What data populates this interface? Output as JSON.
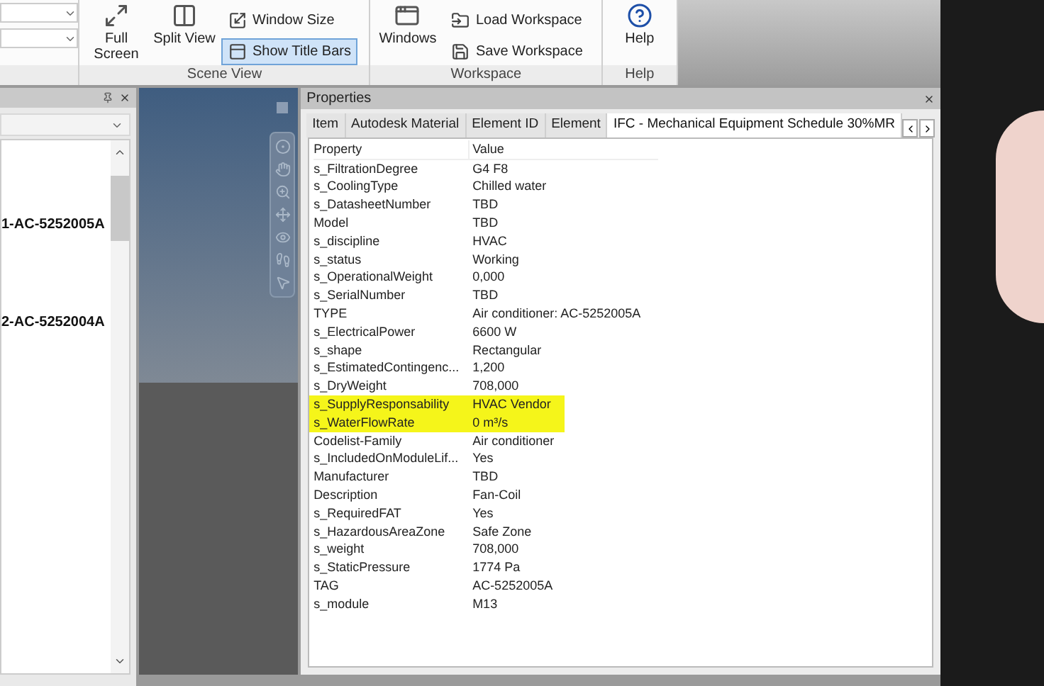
{
  "ribbon": {
    "groups": [
      {
        "kind": "scene",
        "label": "Scene View",
        "large": [
          {
            "label": "Full Screen"
          },
          {
            "label": "Split View"
          }
        ],
        "small": [
          {
            "label": "Window Size",
            "selected": false
          },
          {
            "label": "Show Title Bars",
            "selected": true
          }
        ]
      },
      {
        "kind": "workspace",
        "label": "Workspace",
        "large": [
          {
            "label": "Windows"
          }
        ],
        "small": [
          {
            "label": "Load Workspace",
            "selected": false
          },
          {
            "label": "Save Workspace",
            "selected": false
          }
        ]
      },
      {
        "kind": "help",
        "label": "Help",
        "large": [
          {
            "label": "Help"
          }
        ]
      }
    ]
  },
  "tree_panel": {
    "items": [
      "1-AC-5252005A",
      "2-AC-5252004A"
    ]
  },
  "properties": {
    "title": "Properties",
    "tabs": [
      {
        "label": "Item",
        "selected": false
      },
      {
        "label": "Autodesk Material",
        "selected": false
      },
      {
        "label": "Element ID",
        "selected": false
      },
      {
        "label": "Element",
        "selected": false
      },
      {
        "label": "IFC - Mechanical Equipment Schedule 30%MR",
        "selected": true
      }
    ],
    "columns": [
      "Property",
      "Value"
    ],
    "rows": [
      {
        "property": "s_FiltrationDegree",
        "value": "G4 F8",
        "highlighted": false
      },
      {
        "property": "s_CoolingType",
        "value": "Chilled water",
        "highlighted": false
      },
      {
        "property": "s_DatasheetNumber",
        "value": "TBD",
        "highlighted": false
      },
      {
        "property": "Model",
        "value": "TBD",
        "highlighted": false
      },
      {
        "property": "s_discipline",
        "value": "HVAC",
        "highlighted": false
      },
      {
        "property": "s_status",
        "value": "Working",
        "highlighted": false
      },
      {
        "property": "s_OperationalWeight",
        "value": "0,000",
        "highlighted": false
      },
      {
        "property": "s_SerialNumber",
        "value": "TBD",
        "highlighted": false
      },
      {
        "property": "TYPE",
        "value": "Air conditioner: AC-5252005A",
        "highlighted": false
      },
      {
        "property": "s_ElectricalPower",
        "value": "6600 W",
        "highlighted": false
      },
      {
        "property": "s_shape",
        "value": "Rectangular",
        "highlighted": false
      },
      {
        "property": "s_EstimatedContingenc...",
        "value": "1,200",
        "highlighted": false
      },
      {
        "property": "s_DryWeight",
        "value": "708,000",
        "highlighted": false
      },
      {
        "property": "s_SupplyResponsability",
        "value": "HVAC Vendor",
        "highlighted": true
      },
      {
        "property": "s_WaterFlowRate",
        "value": "0 m³/s",
        "highlighted": true
      },
      {
        "property": "Codelist-Family",
        "value": "Air conditioner",
        "highlighted": false
      },
      {
        "property": "s_IncludedOnModuleLif...",
        "value": "Yes",
        "highlighted": false
      },
      {
        "property": "Manufacturer",
        "value": "TBD",
        "highlighted": false
      },
      {
        "property": "Description",
        "value": "Fan-Coil",
        "highlighted": false
      },
      {
        "property": "s_RequiredFAT",
        "value": "Yes",
        "highlighted": false
      },
      {
        "property": "s_HazardousAreaZone",
        "value": "Safe Zone",
        "highlighted": false
      },
      {
        "property": "s_weight",
        "value": "708,000",
        "highlighted": false
      },
      {
        "property": "s_StaticPressure",
        "value": "1774 Pa",
        "highlighted": false
      },
      {
        "property": "TAG",
        "value": "AC-5252005A",
        "highlighted": false
      },
      {
        "property": "s_module",
        "value": "M13",
        "highlighted": false
      }
    ]
  }
}
